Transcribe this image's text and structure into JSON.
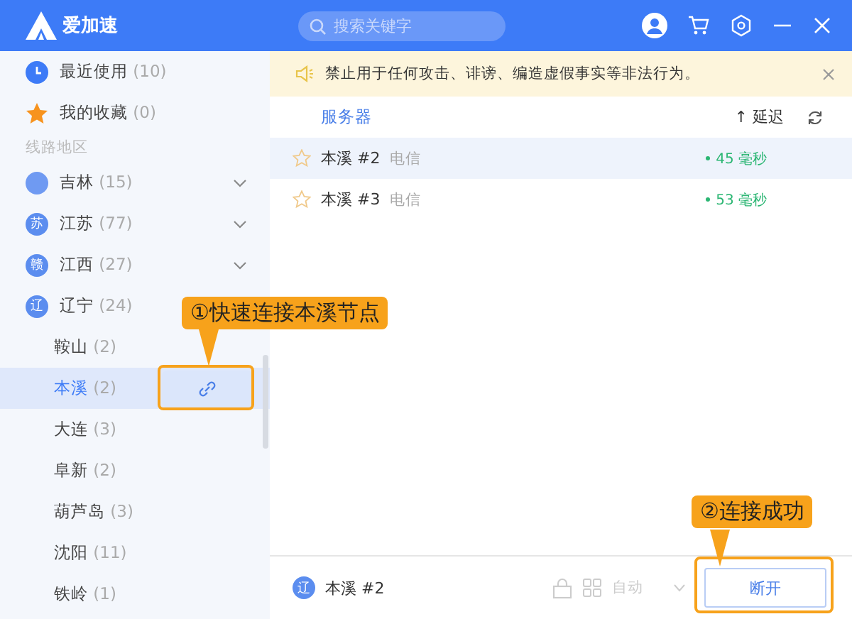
{
  "app": {
    "title": "爱加速"
  },
  "search": {
    "placeholder": "搜索关键字"
  },
  "sidebar": {
    "items": [
      {
        "label": "最近使用",
        "count": "(10)"
      },
      {
        "label": "我的收藏",
        "count": "(0)"
      }
    ],
    "section_label": "线路地区",
    "regions": [
      {
        "label": "吉林",
        "count": "(15)",
        "expanded": false
      },
      {
        "badge": "苏",
        "label": "江苏",
        "count": "(77)",
        "expanded": false
      },
      {
        "badge": "赣",
        "label": "江西",
        "count": "(27)",
        "expanded": false
      },
      {
        "badge": "辽",
        "label": "辽宁",
        "count": "(24)",
        "expanded": true,
        "children": [
          {
            "label": "鞍山",
            "count": "(2)",
            "selected": false
          },
          {
            "label": "本溪",
            "count": "(2)",
            "selected": true
          },
          {
            "label": "大连",
            "count": "(3)",
            "selected": false
          },
          {
            "label": "阜新",
            "count": "(2)",
            "selected": false
          },
          {
            "label": "葫芦岛",
            "count": "(3)",
            "selected": false
          },
          {
            "label": "沈阳",
            "count": "(11)",
            "selected": false
          },
          {
            "label": "铁岭",
            "count": "(1)",
            "selected": false
          }
        ]
      }
    ]
  },
  "notice": {
    "text": "禁止用于任何攻击、诽谤、编造虚假事实等非法行为。"
  },
  "server_list": {
    "columns": {
      "server": "服务器",
      "sort_indicator": "↑",
      "latency": "延迟"
    },
    "rows": [
      {
        "name": "本溪 #2",
        "isp": "电信",
        "latency": "45 毫秒",
        "selected": true,
        "favorite": false
      },
      {
        "name": "本溪 #3",
        "isp": "电信",
        "latency": "53 毫秒",
        "selected": false,
        "favorite": false
      }
    ]
  },
  "footer": {
    "badge": "辽",
    "server": "本溪 #2",
    "mode": "自动",
    "button": "断开"
  },
  "annotations": [
    {
      "text": "①快速连接本溪节点"
    },
    {
      "text": "②连接成功"
    }
  ]
}
